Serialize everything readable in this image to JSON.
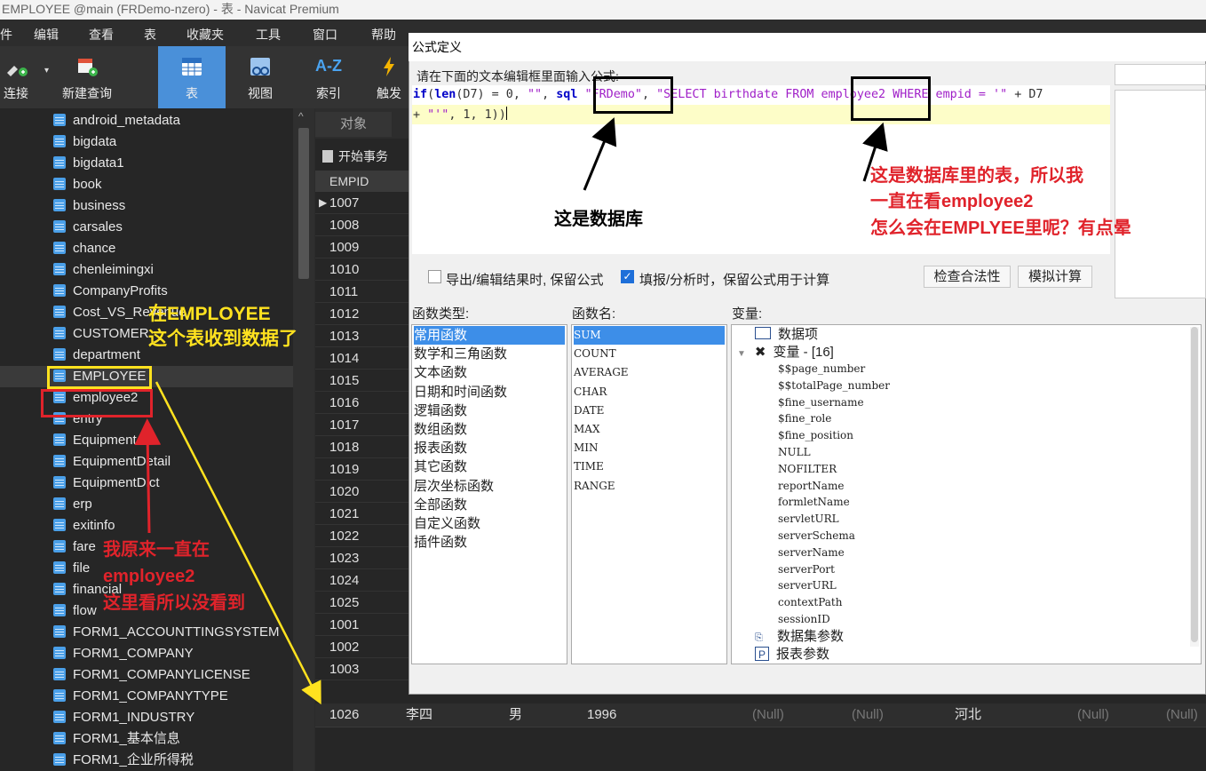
{
  "window_title": "EMPLOYEE @main (FRDemo-nzero) - 表 - Navicat Premium",
  "menu": [
    "件",
    "编辑",
    "查看",
    "表",
    "收藏夹",
    "工具",
    "窗口",
    "帮助"
  ],
  "toolbar": {
    "connect": "连接",
    "new_query": "新建查询",
    "table": "表",
    "view": "视图",
    "index_icon_text": "A-Z",
    "index": "索引",
    "trigger": "触发"
  },
  "tree_items": [
    "android_metadata",
    "bigdata",
    "bigdata1",
    "book",
    "business",
    "carsales",
    "chance",
    "chenleimingxi",
    "CompanyProfits",
    "Cost_VS_Revenue",
    "CUSTOMER",
    "department",
    "EMPLOYEE",
    "employee2",
    "entry",
    "Equipment",
    "EquipmentDetail",
    "EquipmentDict",
    "erp",
    "exitinfo",
    "fare",
    "file",
    "financial",
    "flow",
    "FORM1_ACCOUNTTINGSYSTEM",
    "FORM1_COMPANY",
    "FORM1_COMPANYLICENSE",
    "FORM1_COMPANYTYPE",
    "FORM1_INDUSTRY",
    "FORM1_基本信息",
    "FORM1_企业所得税"
  ],
  "grid": {
    "tab_label": "对象",
    "begin_transaction": "开始事务",
    "column_header": "EMPID",
    "empids": [
      "1007",
      "1008",
      "1009",
      "1010",
      "1011",
      "1012",
      "1013",
      "1014",
      "1015",
      "1016",
      "1017",
      "1018",
      "1019",
      "1020",
      "1021",
      "1022",
      "1023",
      "1024",
      "1025",
      "1001",
      "1002",
      "1003"
    ],
    "last_row": {
      "empid": "1026",
      "name": "李四",
      "gender": "男",
      "birth": "1996",
      "null1": "(Null)",
      "null2": "(Null)",
      "province": "河北",
      "null3": "(Null)",
      "null4": "(Null)"
    }
  },
  "dialog": {
    "title": "公式定义",
    "prompt": "请在下面的文本编辑框里面输入公式:",
    "formula_line1": {
      "if": "if",
      "p1": "(",
      "len": "len",
      "p2": "(D7) = 0, ",
      "s1": "\"\"",
      "p3": ", ",
      "sql": "sql",
      "p4": " ",
      "s2": "\"FRDemo\"",
      "p5": ", ",
      "s3": "\"SELECT birthdate FROM employee2 WHERE empid = '\"",
      "p6": " + D7"
    },
    "formula_line2": {
      "p1": "+ ",
      "s1": "\"'\"",
      "p2": ", 1, 1))"
    },
    "checkbox_export": "导出/编辑结果时, 保留公式",
    "checkbox_fill": "填报/分析时，保留公式用于计算",
    "btn_check": "检查合法性",
    "btn_simulate": "模拟计算",
    "label_func_type": "函数类型:",
    "label_func_name": "函数名:",
    "label_variables": "变量:",
    "func_types": [
      "常用函数",
      "数学和三角函数",
      "文本函数",
      "日期和时间函数",
      "逻辑函数",
      "数组函数",
      "报表函数",
      "其它函数",
      "层次坐标函数",
      "全部函数",
      "自定义函数",
      "插件函数"
    ],
    "func_names": [
      "SUM",
      "COUNT",
      "AVERAGE",
      "CHAR",
      "DATE",
      "MAX",
      "MIN",
      "TIME",
      "RANGE"
    ],
    "var_data_items": "数据项",
    "var_group": "变量 - [16]",
    "variables": [
      "$$page_number",
      "$$totalPage_number",
      "$fine_username",
      "$fine_role",
      "$fine_position",
      "NULL",
      "NOFILTER",
      "reportName",
      "formletName",
      "servletURL",
      "serverSchema",
      "serverName",
      "serverPort",
      "serverURL",
      "contextPath",
      "sessionID"
    ],
    "var_dataset_params": "数据集参数",
    "var_report_params": "报表参数"
  },
  "annotations": {
    "db_note": "这是数据库",
    "table_note_1": "这是数据库里的表，所以我",
    "table_note_2": "一直在看employee2",
    "table_note_3": "怎么会在EMPLYEE里呢？有点晕",
    "yellow_1": "在EMPLOYEE",
    "yellow_2": "这个表收到数据了",
    "red_1": "我原来一直在",
    "red_2": "employee2",
    "red_3": "这里看所以没看到"
  },
  "colors": {
    "selection_blue": "#3d8ee8",
    "annotation_red": "#e0232b",
    "annotation_yellow": "#ffe21f",
    "keyword_blue": "#0000c8",
    "string_purple": "#a020c8"
  }
}
